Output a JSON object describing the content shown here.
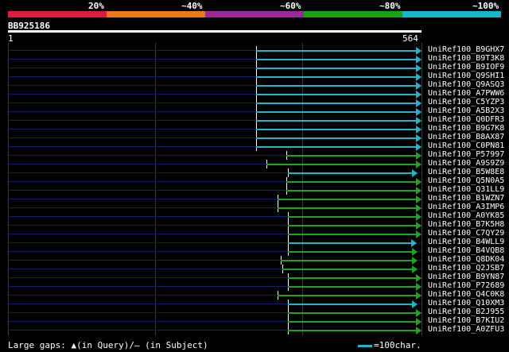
{
  "scale": {
    "labels": [
      "20%",
      "~40%",
      "~60%",
      "~80%",
      "~100%"
    ],
    "colors": [
      "#e01a3c",
      "#ea7a16",
      "#9a2a9a",
      "#1aa11a",
      "#13b9c6"
    ]
  },
  "query": {
    "name": "BB925186",
    "start": "1",
    "end": "564",
    "length": 564
  },
  "hits": [
    {
      "label": "UniRef100_B9GHX7",
      "start": 338,
      "end": 564,
      "color": "#22b5c9"
    },
    {
      "label": "UniRef100_B9T3K8",
      "start": 338,
      "end": 564,
      "color": "#22b5c9"
    },
    {
      "label": "UniRef100_B9IOF9",
      "start": 338,
      "end": 564,
      "color": "#22b5c9"
    },
    {
      "label": "UniRef100_Q9SHI1",
      "start": 338,
      "end": 564,
      "color": "#22b5c9"
    },
    {
      "label": "UniRef100_Q9ASQ3",
      "start": 338,
      "end": 564,
      "color": "#22b5c9"
    },
    {
      "label": "UniRef100_A7PWW6",
      "start": 338,
      "end": 564,
      "color": "#22b5c9"
    },
    {
      "label": "UniRef100_C5YZP3",
      "start": 338,
      "end": 564,
      "color": "#22b5c9"
    },
    {
      "label": "UniRef100_A5B2X3",
      "start": 338,
      "end": 564,
      "color": "#22b5c9"
    },
    {
      "label": "UniRef100_Q0DFR3",
      "start": 338,
      "end": 564,
      "color": "#22b5c9"
    },
    {
      "label": "UniRef100_B9G7K8",
      "start": 338,
      "end": 564,
      "color": "#22b5c9"
    },
    {
      "label": "UniRef100_B8AX87",
      "start": 338,
      "end": 564,
      "color": "#22b5c9"
    },
    {
      "label": "UniRef100_C0PN81",
      "start": 338,
      "end": 564,
      "color": "#22b5c9"
    },
    {
      "label": "UniRef100_P57997",
      "start": 380,
      "end": 564,
      "color": "#1fa41f"
    },
    {
      "label": "UniRef100_A9S9Z9",
      "start": 352,
      "end": 564,
      "color": "#1fa41f"
    },
    {
      "label": "UniRef100_B5W8E8",
      "start": 382,
      "end": 559,
      "color": "#22b5c9"
    },
    {
      "label": "UniRef100_Q5N0A5",
      "start": 380,
      "end": 564,
      "color": "#1fa41f"
    },
    {
      "label": "UniRef100_Q31LL9",
      "start": 380,
      "end": 564,
      "color": "#1fa41f"
    },
    {
      "label": "UniRef100_B1WZN7",
      "start": 368,
      "end": 564,
      "color": "#1fa41f"
    },
    {
      "label": "UniRef100_A3IMP6",
      "start": 368,
      "end": 564,
      "color": "#1fa41f"
    },
    {
      "label": "UniRef100_A0YK85",
      "start": 382,
      "end": 564,
      "color": "#1fa41f"
    },
    {
      "label": "UniRef100_B7K5H8",
      "start": 382,
      "end": 564,
      "color": "#1fa41f"
    },
    {
      "label": "UniRef100_C7QY29",
      "start": 382,
      "end": 564,
      "color": "#1fa41f"
    },
    {
      "label": "UniRef100_B4WLL9",
      "start": 382,
      "end": 557,
      "color": "#22b5c9"
    },
    {
      "label": "UniRef100_B4VQB8",
      "start": 382,
      "end": 559,
      "color": "#1fa41f"
    },
    {
      "label": "UniRef100_Q8DK04",
      "start": 372,
      "end": 559,
      "color": "#1fa41f"
    },
    {
      "label": "UniRef100_Q2JSB7",
      "start": 374,
      "end": 559,
      "color": "#1fa41f"
    },
    {
      "label": "UniRef100_B9YN87",
      "start": 382,
      "end": 564,
      "color": "#1fa41f"
    },
    {
      "label": "UniRef100_P72689",
      "start": 382,
      "end": 564,
      "color": "#1fa41f"
    },
    {
      "label": "UniRef100_Q4C0K8",
      "start": 368,
      "end": 564,
      "color": "#1fa41f"
    },
    {
      "label": "UniRef100_Q10XM3",
      "start": 382,
      "end": 559,
      "color": "#22b5c9"
    },
    {
      "label": "UniRef100_B2J955",
      "start": 382,
      "end": 564,
      "color": "#1fa41f"
    },
    {
      "label": "UniRef100_B7KIU2",
      "start": 382,
      "end": 564,
      "color": "#1fa41f"
    },
    {
      "label": "UniRef100_A0ZFU3",
      "start": 382,
      "end": 564,
      "color": "#1fa41f"
    }
  ],
  "legend": {
    "gaps_text": "Large gaps: ▲(in Query)/– (in Subject)",
    "scale_text": "=100char.",
    "scale_color": "#22b5c9"
  }
}
